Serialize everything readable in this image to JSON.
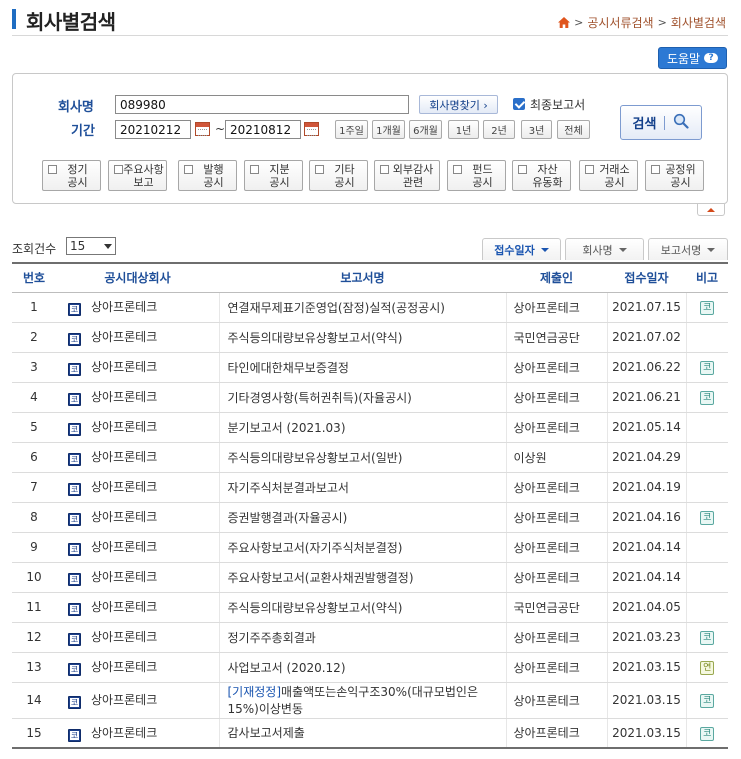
{
  "header": {
    "title": "회사별검색",
    "breadcrumb": [
      "공시서류검색",
      "회사별검색"
    ],
    "help_label": "도움말",
    "help_icon_text": "?"
  },
  "search": {
    "company_label": "회사명",
    "company_value": "089980",
    "find_company_label": "회사명찾기 ›",
    "final_report_label": "최종보고서",
    "final_report_checked": true,
    "period_label": "기간",
    "date_from": "20210212",
    "date_to": "20210812",
    "date_sep": "~",
    "period_buttons": [
      "1주일",
      "1개월",
      "6개월",
      "1년",
      "2년",
      "3년",
      "전체"
    ],
    "search_label": "검색",
    "report_types": [
      [
        "정기",
        "공시"
      ],
      [
        "주요사항",
        "보고"
      ],
      [
        "발행",
        "공시"
      ],
      [
        "지분",
        "공시"
      ],
      [
        "기타",
        "공시"
      ],
      [
        "외부감사",
        "관련"
      ],
      [
        "펀드",
        "공시"
      ],
      [
        "자산",
        "유동화"
      ],
      [
        "거래소",
        "공시"
      ],
      [
        "공정위",
        "공시"
      ]
    ]
  },
  "listing": {
    "count_label": "조회건수",
    "count_value": "15",
    "sort_buttons": [
      "접수일자",
      "회사명",
      "보고서명"
    ],
    "columns": [
      "번호",
      "공시대상회사",
      "보고서명",
      "제출인",
      "접수일자",
      "비고"
    ],
    "rows": [
      {
        "no": "1",
        "market": "코",
        "company": "상아프론테크",
        "tag": "",
        "report": "연결재무제표기준영업(잠정)실적(공정공시)",
        "submitter": "상아프론테크",
        "date": "2021.07.15",
        "remark": "코"
      },
      {
        "no": "2",
        "market": "코",
        "company": "상아프론테크",
        "tag": "",
        "report": "주식등의대량보유상황보고서(약식)",
        "submitter": "국민연금공단",
        "date": "2021.07.02",
        "remark": ""
      },
      {
        "no": "3",
        "market": "코",
        "company": "상아프론테크",
        "tag": "",
        "report": "타인에대한채무보증결정",
        "submitter": "상아프론테크",
        "date": "2021.06.22",
        "remark": "코"
      },
      {
        "no": "4",
        "market": "코",
        "company": "상아프론테크",
        "tag": "",
        "report": "기타경영사항(특허권취득)(자율공시)",
        "submitter": "상아프론테크",
        "date": "2021.06.21",
        "remark": "코"
      },
      {
        "no": "5",
        "market": "코",
        "company": "상아프론테크",
        "tag": "",
        "report": "분기보고서 (2021.03)",
        "submitter": "상아프론테크",
        "date": "2021.05.14",
        "remark": ""
      },
      {
        "no": "6",
        "market": "코",
        "company": "상아프론테크",
        "tag": "",
        "report": "주식등의대량보유상황보고서(일반)",
        "submitter": "이상원",
        "date": "2021.04.29",
        "remark": ""
      },
      {
        "no": "7",
        "market": "코",
        "company": "상아프론테크",
        "tag": "",
        "report": "자기주식처분결과보고서",
        "submitter": "상아프론테크",
        "date": "2021.04.19",
        "remark": ""
      },
      {
        "no": "8",
        "market": "코",
        "company": "상아프론테크",
        "tag": "",
        "report": "증권발행결과(자율공시)",
        "submitter": "상아프론테크",
        "date": "2021.04.16",
        "remark": "코"
      },
      {
        "no": "9",
        "market": "코",
        "company": "상아프론테크",
        "tag": "",
        "report": "주요사항보고서(자기주식처분결정)",
        "submitter": "상아프론테크",
        "date": "2021.04.14",
        "remark": ""
      },
      {
        "no": "10",
        "market": "코",
        "company": "상아프론테크",
        "tag": "",
        "report": "주요사항보고서(교환사채권발행결정)",
        "submitter": "상아프론테크",
        "date": "2021.04.14",
        "remark": ""
      },
      {
        "no": "11",
        "market": "코",
        "company": "상아프론테크",
        "tag": "",
        "report": "주식등의대량보유상황보고서(약식)",
        "submitter": "국민연금공단",
        "date": "2021.04.05",
        "remark": ""
      },
      {
        "no": "12",
        "market": "코",
        "company": "상아프론테크",
        "tag": "",
        "report": "정기주주총회결과",
        "submitter": "상아프론테크",
        "date": "2021.03.23",
        "remark": "코"
      },
      {
        "no": "13",
        "market": "코",
        "company": "상아프론테크",
        "tag": "",
        "report": "사업보고서 (2020.12)",
        "submitter": "상아프론테크",
        "date": "2021.03.15",
        "remark": "연"
      },
      {
        "no": "14",
        "market": "코",
        "company": "상아프론테크",
        "tag": "[기재정정]",
        "report": "매출액또는손익구조30%(대규모법인은15%)이상변동",
        "submitter": "상아프론테크",
        "date": "2021.03.15",
        "remark": "코"
      },
      {
        "no": "15",
        "market": "코",
        "company": "상아프론테크",
        "tag": "",
        "report": "감사보고서제출",
        "submitter": "상아프론테크",
        "date": "2021.03.15",
        "remark": "코"
      }
    ]
  }
}
